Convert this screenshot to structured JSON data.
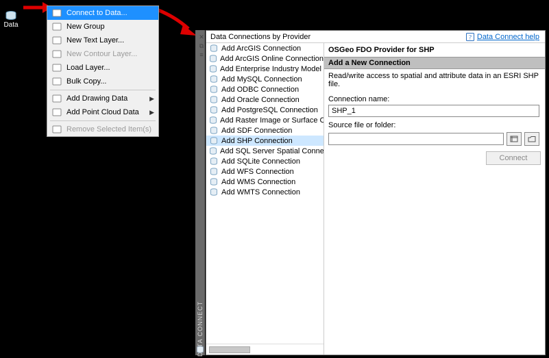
{
  "data_button": {
    "label": "Data"
  },
  "context_menu": {
    "items": [
      {
        "label": "Connect to Data...",
        "selected": true,
        "has_sub": false,
        "disabled": false
      },
      {
        "label": "New Group",
        "selected": false,
        "has_sub": false,
        "disabled": false
      },
      {
        "label": "New Text Layer...",
        "selected": false,
        "has_sub": false,
        "disabled": false
      },
      {
        "label": "New Contour Layer...",
        "selected": false,
        "has_sub": false,
        "disabled": true
      },
      {
        "label": "Load Layer...",
        "selected": false,
        "has_sub": false,
        "disabled": false
      },
      {
        "label": "Bulk Copy...",
        "selected": false,
        "has_sub": false,
        "disabled": false
      }
    ],
    "items2": [
      {
        "label": "Add Drawing Data",
        "has_sub": true,
        "disabled": false
      },
      {
        "label": "Add Point Cloud Data",
        "has_sub": true,
        "disabled": false
      }
    ],
    "items3": [
      {
        "label": "Remove Selected Item(s)",
        "has_sub": false,
        "disabled": true
      }
    ]
  },
  "panel": {
    "header_title": "Data Connections by Provider",
    "help_link": "Data Connect help",
    "providers": [
      "Add ArcGIS Connection",
      "Add ArcGIS Online Connection",
      "Add Enterprise Industry Model Connection",
      "Add MySQL Connection",
      "Add ODBC Connection",
      "Add Oracle Connection",
      "Add PostgreSQL Connection",
      "Add Raster Image or Surface Connection",
      "Add SDF Connection",
      "Add SHP Connection",
      "Add SQL Server Spatial Connection",
      "Add SQLite Connection",
      "Add WFS Connection",
      "Add WMS Connection",
      "Add WMTS Connection"
    ],
    "provider_selected_index": 9,
    "right": {
      "title": "OSGeo FDO Provider for SHP",
      "section": "Add a New Connection",
      "description": "Read/write access to spatial and attribute data in an ESRI SHP file.",
      "conn_name_label": "Connection name:",
      "conn_name_value": "SHP_1",
      "source_label": "Source file or folder:",
      "source_value": "",
      "connect_button": "Connect"
    },
    "vertical_label": "DATA CONNECT"
  }
}
